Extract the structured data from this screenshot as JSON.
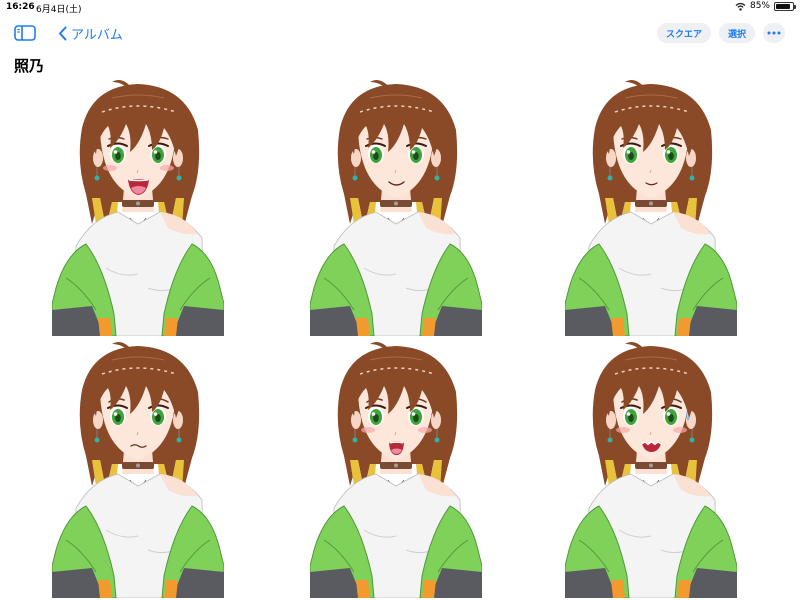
{
  "status": {
    "time": "16:26",
    "date": "6月4日(土)",
    "battery": "85%",
    "battery_level": 0.85
  },
  "nav": {
    "sidebar_icon": "sidebar-icon",
    "back_label": "アルバム",
    "square_label": "スクエア",
    "select_label": "選択",
    "more_icon": "ellipsis-icon"
  },
  "album": {
    "title": "照乃"
  },
  "photos": [
    {
      "expression": "laughing",
      "name": "photo-1"
    },
    {
      "expression": "smiling",
      "name": "photo-2"
    },
    {
      "expression": "gentle-smile",
      "name": "photo-3"
    },
    {
      "expression": "troubled",
      "name": "photo-4"
    },
    {
      "expression": "surprised",
      "name": "photo-5"
    },
    {
      "expression": "flustered",
      "name": "photo-6"
    }
  ],
  "colors": {
    "accent": "#1e7cf2",
    "hair": "#8a4a28",
    "hair_highlight": "#e8c23a",
    "eyes": "#3fa53a",
    "jacket": "#7fd15a",
    "sleeve": "#595b60",
    "cuff": "#f29a2e"
  }
}
